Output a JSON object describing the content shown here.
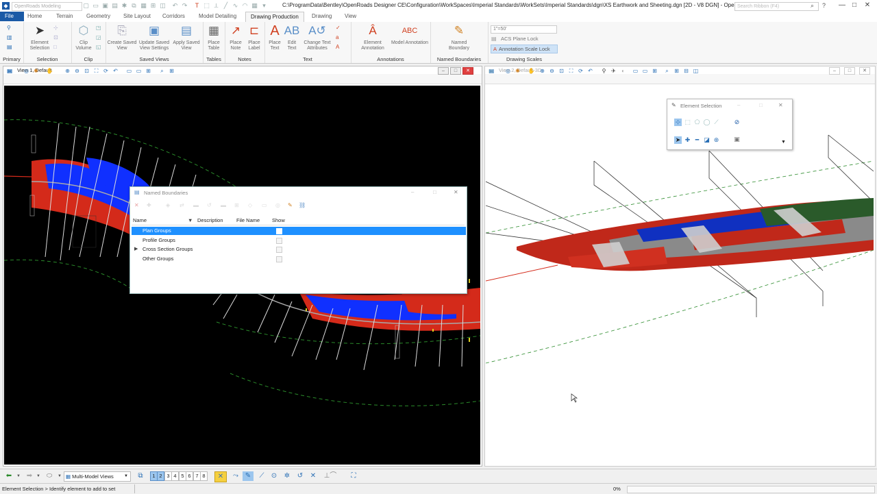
{
  "title_bar": {
    "workspace": "OpenRoads Modeling",
    "title": "C:\\ProgramData\\Bentley\\OpenRoads Designer CE\\Configuration\\WorkSpaces\\Imperial Standards\\WorkSets\\Imperial Standards\\dgn\\XS Earthwork and Sheeting.dgn [2D - V8 DGN] - Ope...",
    "search_placeholder": "Search Ribbon (F4)",
    "minimize": "—",
    "maximize": "□",
    "close": "✕"
  },
  "tabs": [
    "File",
    "Home",
    "Terrain",
    "Geometry",
    "Site Layout",
    "Corridors",
    "Model Detailing",
    "Drawing Production",
    "Drawing",
    "View"
  ],
  "active_tab": "Drawing Production",
  "ribbon": {
    "groups": [
      {
        "label": "Primary"
      },
      {
        "label": "Selection",
        "buttons": [
          "Element Selection"
        ]
      },
      {
        "label": "Clip",
        "buttons": [
          "Clip Volume"
        ]
      },
      {
        "label": "Saved Views",
        "buttons": [
          "Create Saved View",
          "Update Saved View Settings",
          "Apply Saved View"
        ]
      },
      {
        "label": "Tables",
        "buttons": [
          "Place Table"
        ]
      },
      {
        "label": "Notes",
        "buttons": [
          "Place Note",
          "Place Label"
        ]
      },
      {
        "label": "Text",
        "buttons": [
          "Place Text",
          "Edit Text",
          "Change Text Attributes"
        ]
      },
      {
        "label": "Annotations",
        "buttons": [
          "Element Annotation",
          "Model Annotation"
        ]
      },
      {
        "label": "Named Boundaries",
        "buttons": [
          "Named Boundary"
        ]
      },
      {
        "label": "Drawing Scales"
      }
    ],
    "scale_value": "1\"=50'",
    "acs_plane_lock": "ACS Plane Lock",
    "annotation_scale_lock": "Annotation Scale Lock"
  },
  "view1": {
    "title": "View 1, Default"
  },
  "view2": {
    "title": "View 2, Default-3D"
  },
  "named_boundaries": {
    "title": "Named Boundaries",
    "columns": [
      "Name",
      "Description",
      "File Name",
      "Show"
    ],
    "rows": [
      {
        "name": "Plan Groups",
        "selected": true,
        "expandable": false
      },
      {
        "name": "Profile Groups",
        "selected": false,
        "expandable": false
      },
      {
        "name": "Cross Section Groups",
        "selected": false,
        "expandable": true
      },
      {
        "name": "Other Groups",
        "selected": false,
        "expandable": false
      }
    ]
  },
  "element_selection": {
    "title": "Element Selection"
  },
  "bottom_bar": {
    "view_mode": "Multi-Model Views",
    "view_numbers": [
      "1",
      "2",
      "3",
      "4",
      "5",
      "6",
      "7",
      "8"
    ],
    "active_views": [
      "1",
      "2"
    ]
  },
  "status": {
    "message": "Element Selection > Identify element to add to set",
    "progress": "0%"
  },
  "colors": {
    "accent_blue": "#1b5aa6",
    "selection_blue": "#1e90ff",
    "corridor_red": "#d42a1a",
    "corridor_blue": "#1030ff"
  }
}
